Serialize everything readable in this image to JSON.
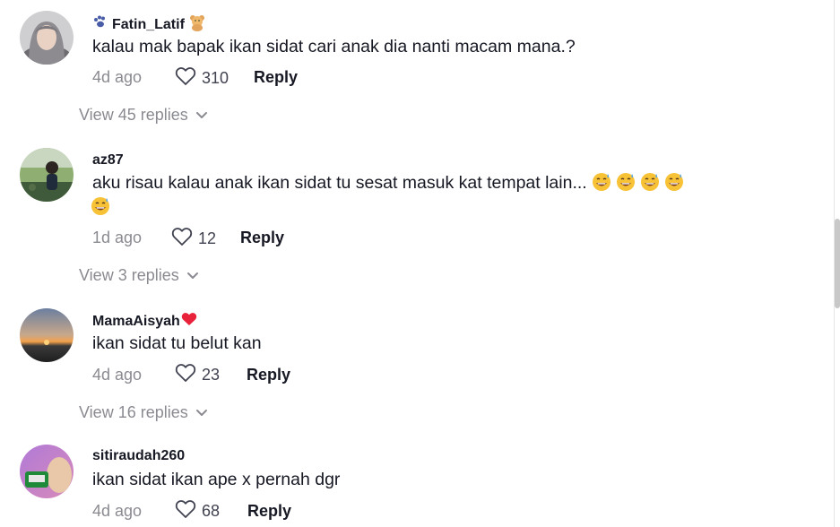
{
  "comments": [
    {
      "username": "Fatin_Latif",
      "text": "kalau mak bapak ikan sidat cari anak dia nanti macam mana.?",
      "text_line2": "",
      "time": "4d ago",
      "likes": "310",
      "reply_label": "Reply",
      "view_replies": "View 45 replies"
    },
    {
      "username": "az87",
      "text": "aku risau kalau anak ikan sidat tu sesat masuk kat tempat lain...",
      "text_line2": "",
      "time": "1d ago",
      "likes": "12",
      "reply_label": "Reply",
      "view_replies": "View 3 replies"
    },
    {
      "username": "MamaAisyah",
      "text": "ikan sidat tu belut kan",
      "text_line2": "",
      "time": "4d ago",
      "likes": "23",
      "reply_label": "Reply",
      "view_replies": "View 16 replies"
    },
    {
      "username": "sitiraudah260",
      "text": "ikan sidat ikan ape x pernah dgr",
      "text_line2": "",
      "time": "4d ago",
      "likes": "68",
      "reply_label": "Reply",
      "view_replies": ""
    }
  ],
  "colors": {
    "text": "#161823",
    "muted": "#8a8b91",
    "heart_badge": "#fe2c55"
  },
  "icons": {
    "like": "heart-outline-icon",
    "expand": "chevron-down-icon",
    "emoji": "grinning-sweat-emoji",
    "paw": "paw-icon",
    "bear": "teddy-bear-icon",
    "red_heart": "red-heart-icon"
  }
}
